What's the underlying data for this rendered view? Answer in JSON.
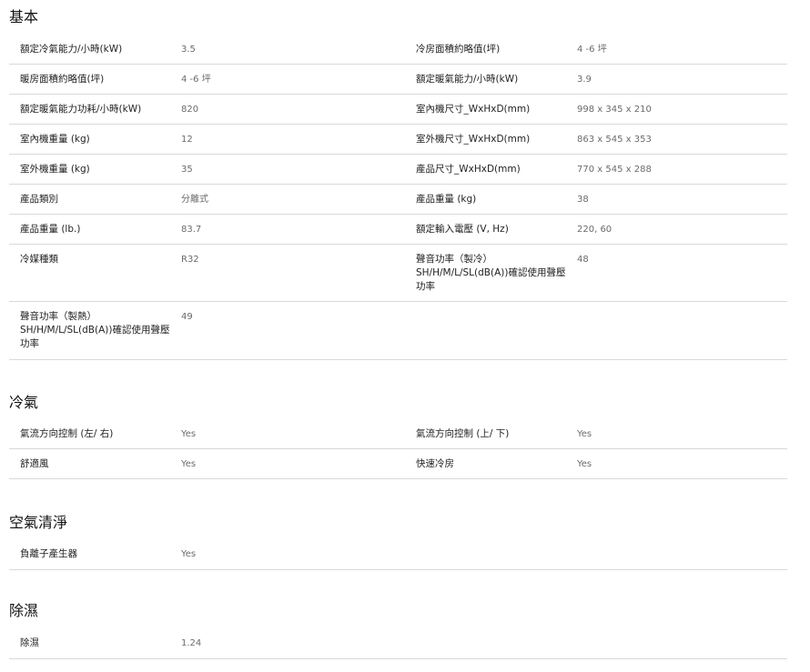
{
  "sections": [
    {
      "title": "基本",
      "rows": [
        [
          {
            "label": "額定冷氣能力/小時(kW)",
            "value": "3.5"
          },
          {
            "label": "冷房面積約略值(坪)",
            "value": "4 -6 坪"
          }
        ],
        [
          {
            "label": "暖房面積約略值(坪)",
            "value": "4 -6 坪"
          },
          {
            "label": "額定暖氣能力/小時(kW)",
            "value": "3.9"
          }
        ],
        [
          {
            "label": "額定暖氣能力功耗/小時(kW)",
            "value": "820"
          },
          {
            "label": "室內機尺寸_WxHxD(mm)",
            "value": "998 x 345 x 210"
          }
        ],
        [
          {
            "label": "室內機重量 (kg)",
            "value": "12"
          },
          {
            "label": "室外機尺寸_WxHxD(mm)",
            "value": "863 x 545 x 353"
          }
        ],
        [
          {
            "label": "室外機重量 (kg)",
            "value": "35"
          },
          {
            "label": "產品尺寸_WxHxD(mm)",
            "value": "770 x 545 x 288"
          }
        ],
        [
          {
            "label": "產品類別",
            "value": "分離式"
          },
          {
            "label": "產品重量 (kg)",
            "value": "38"
          }
        ],
        [
          {
            "label": "產品重量 (lb.)",
            "value": "83.7"
          },
          {
            "label": "額定輸入電壓 (V, Hz)",
            "value": "220, 60"
          }
        ],
        [
          {
            "label": "冷媒種類",
            "value": "R32"
          },
          {
            "label": "聲音功率（製冷）SH/H/M/L/SL(dB(A))確認使用聲壓功率",
            "value": "48"
          }
        ],
        [
          {
            "label": "聲音功率（製熱）SH/H/M/L/SL(dB(A))確認使用聲壓功率",
            "value": "49"
          }
        ]
      ]
    },
    {
      "title": "冷氣",
      "rows": [
        [
          {
            "label": "氣流方向控制 (左/ 右)",
            "value": "Yes"
          },
          {
            "label": "氣流方向控制 (上/ 下)",
            "value": "Yes"
          }
        ],
        [
          {
            "label": "舒適風",
            "value": "Yes"
          },
          {
            "label": "快速冷房",
            "value": "Yes"
          }
        ]
      ]
    },
    {
      "title": "空氣清淨",
      "rows": [
        [
          {
            "label": "負離子產生器",
            "value": "Yes"
          }
        ]
      ]
    },
    {
      "title": "除濕",
      "rows": [
        [
          {
            "label": "除濕",
            "value": "1.24"
          }
        ]
      ]
    }
  ]
}
